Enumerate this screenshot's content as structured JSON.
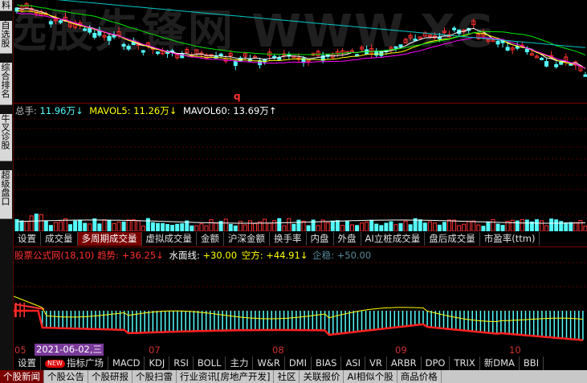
{
  "watermark": "选股先锋网 WWW.XG",
  "sidebar": [
    {
      "label": "自选股"
    },
    {
      "label": "综合排名"
    },
    {
      "label": "牛叉诊股"
    },
    {
      "label": "超级盘口"
    }
  ],
  "kline_marker": "q",
  "volume_info": {
    "total_label": "总手:",
    "total_value": "11.96万↓",
    "ma5_label": "MAVOL5:",
    "ma5_value": "11.26万↓",
    "ma60_label": "MAVOL60:",
    "ma60_value": "13.69万↑"
  },
  "volume_tabs": [
    "设置",
    "成交量",
    "多周期成交量",
    "虚拟成交量",
    "金额",
    "沪深金额",
    "换手率",
    "内盘",
    "外盘",
    "AI立桩成交量",
    "盘后成交量",
    "市盈率(ttm)"
  ],
  "volume_tab_active": 2,
  "indicator_info": {
    "name": "股票公式网(18,10)",
    "trend_label": "趋势:",
    "trend_value": "+36.25↓",
    "water_label": "水面线:",
    "water_value": "+30.00",
    "short_label": "空方:",
    "short_value": "+44.91↓",
    "stable_label": "企稳:",
    "stable_value": "+50.00"
  },
  "date_axis": {
    "labels": [
      "05",
      "07",
      "08",
      "09",
      "10"
    ],
    "cursor_date": "2021-06-02,三"
  },
  "indicator_tabs": {
    "settings": "设置",
    "new_badge": "NEW",
    "items": [
      "指标广场",
      "MACD",
      "KDJ",
      "RSI",
      "BOLL",
      "主力",
      "W&R",
      "DMI",
      "BIAS",
      "ASI",
      "VR",
      "ARBR",
      "DPO",
      "TRIX",
      "新DMA",
      "BBI"
    ]
  },
  "bottom_tabs": [
    "个股新闻",
    "个股公告",
    "个股研报",
    "个股扫雷",
    "行业资讯[房地产开发]",
    "社区",
    "关联报价",
    "AI相似个股",
    "商品价格"
  ],
  "bottom_tab_active": 0,
  "colors": {
    "up": "#ff3232",
    "down": "#54fcfc",
    "ma_white": "#ffffff",
    "ma_yellow": "#ffff00",
    "ma_magenta": "#ff00ff",
    "ma_green": "#00e600",
    "ma_cyan": "#00c8c8",
    "accent": "#7a0000"
  }
}
